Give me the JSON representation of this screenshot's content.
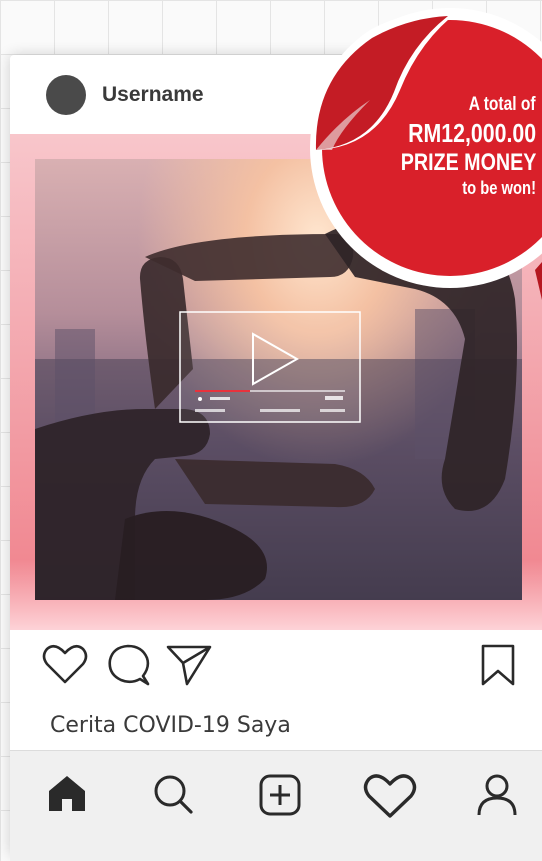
{
  "post": {
    "username": "Username",
    "caption": "Cerita COVID-19 Saya"
  },
  "icons": {
    "like": "heart-icon",
    "comment": "comment-icon",
    "share": "send-icon",
    "save": "bookmark-icon"
  },
  "bottom_nav": [
    "home-icon",
    "search-icon",
    "add-post-icon",
    "activity-heart-icon",
    "profile-icon"
  ],
  "sticker": {
    "line1": "A total of",
    "line2": "RM12,000.00",
    "line3": "PRIZE MONEY",
    "line4": "to be won!"
  },
  "colors": {
    "sticker_red": "#d9202a",
    "frame_pink": "#f3a7ae"
  }
}
